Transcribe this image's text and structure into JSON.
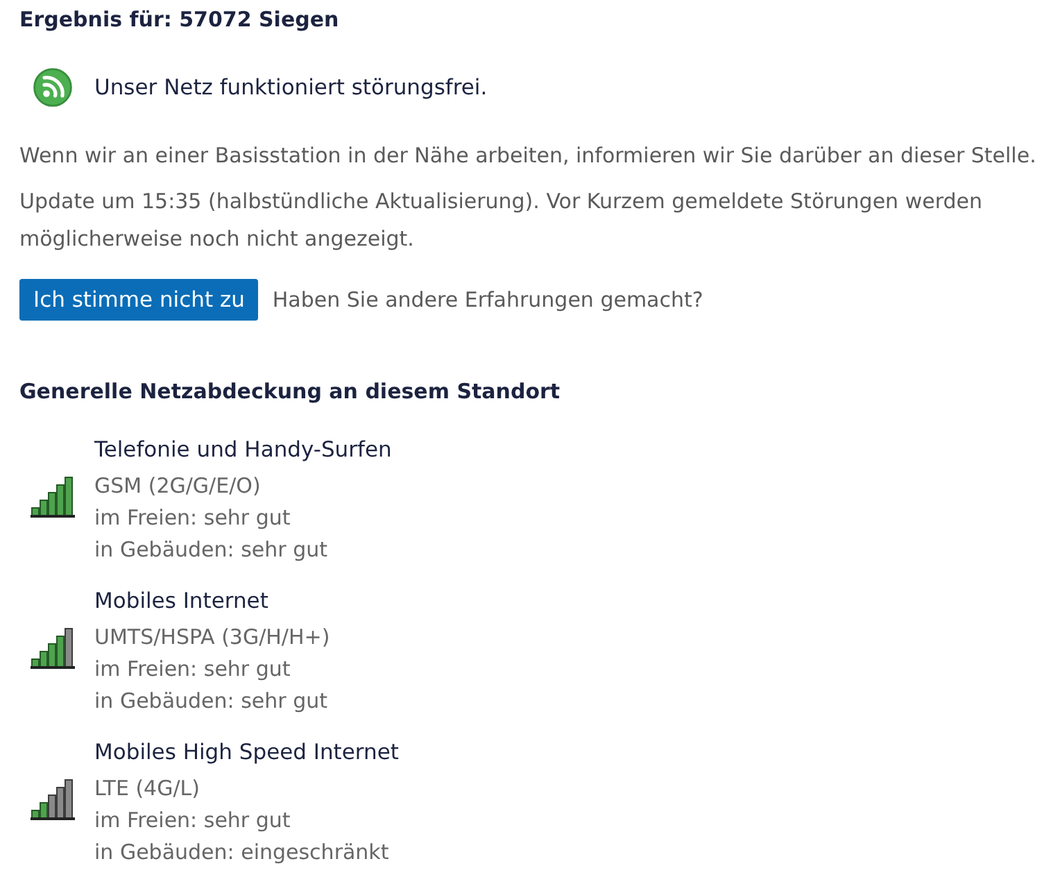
{
  "result_title": "Ergebnis für: 57072 Siegen",
  "status": {
    "kind": "ok",
    "message": "Unser Netz funktioniert störungsfrei."
  },
  "notes": [
    "Wenn wir an einer Basisstation in der Nähe arbeiten, informieren wir Sie darüber an dieser Stelle.",
    "Update um 15:35 (halbstündliche Aktualisierung). Vor Kurzem gemeldete Störungen werden möglicherweise noch nicht angezeigt."
  ],
  "disagree": {
    "button": "Ich stimme nicht zu",
    "prompt": "Haben Sie andere Erfahrungen gemacht?"
  },
  "coverage": {
    "heading": "Generelle Netzabdeckung an diesem Standort",
    "services": [
      {
        "kind": "excellent",
        "name": "Telefonie und Handy-Surfen",
        "technology": "GSM (2G/G/E/O)",
        "outdoor": "im Freien: sehr gut",
        "indoor": "in Gebäuden: sehr gut"
      },
      {
        "kind": "good",
        "name": "Mobiles Internet",
        "technology": "UMTS/HSPA (3G/H/H+)",
        "outdoor": "im Freien: sehr gut",
        "indoor": "in Gebäuden: sehr gut"
      },
      {
        "kind": "limited",
        "name": "Mobiles High Speed Internet",
        "technology": "LTE (4G/L)",
        "outdoor": "im Freien: sehr gut",
        "indoor": "in Gebäuden: eingeschränkt"
      }
    ]
  }
}
